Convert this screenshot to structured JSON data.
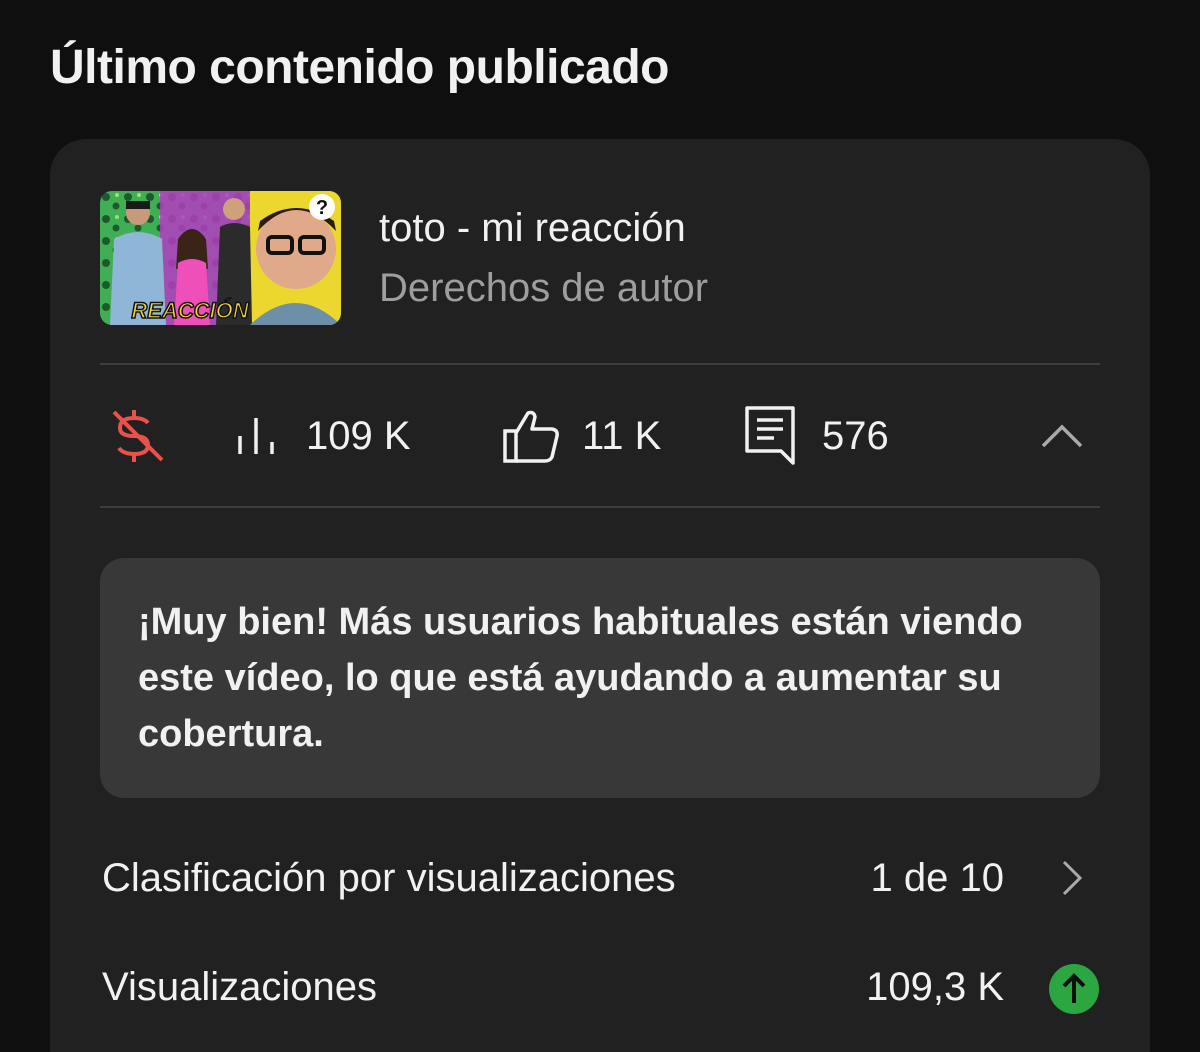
{
  "section": {
    "title": "Último contenido publicado"
  },
  "video": {
    "thumbnail_label": "REACCIÓN",
    "thumbnail_badge": "?",
    "title": "toto - mi reacción",
    "subtitle": "Derechos de autor"
  },
  "stats": {
    "monetization_icon": "dollar-off-icon",
    "views_icon": "bar-chart-icon",
    "views": "109 K",
    "likes_icon": "thumbs-up-icon",
    "likes": "11 K",
    "comments_icon": "comment-icon",
    "comments": "576",
    "collapse_icon": "chevron-up-icon"
  },
  "insight": {
    "text": "¡Muy bien! Más usuarios habituales están viendo este vídeo, lo que está ayudando a aumentar su cobertura."
  },
  "metrics": [
    {
      "label": "Clasificación por visualizaciones",
      "value": "1 de 10",
      "trailing_icon": "chevron-right-icon"
    },
    {
      "label": "Visualizaciones",
      "value": "109,3 K",
      "trailing_icon": "arrow-up-circle-icon"
    }
  ],
  "colors": {
    "background": "#0f0f0f",
    "card": "#212121",
    "insight_box": "#383838",
    "monetization_off": "#e8524a",
    "trend_up": "#2ba640",
    "secondary_text": "#9e9e9e"
  }
}
